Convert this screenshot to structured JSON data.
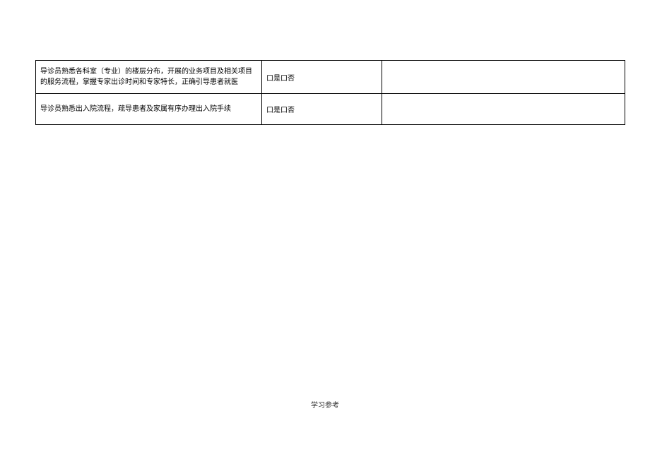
{
  "table": {
    "rows": [
      {
        "description": "导诊员熟悉各科室（专业）的楼层分布，开展的业务项目及相关项目的服务流程，掌握专家出诊时间和专家特长，正确引导患者就医",
        "option": "口是口否",
        "remark": ""
      },
      {
        "description": "导诊员熟悉出入院流程，疏导患者及家属有序办理出入院手续",
        "option": "口是口否",
        "remark": ""
      }
    ]
  },
  "footer": {
    "text": "学习参考"
  }
}
